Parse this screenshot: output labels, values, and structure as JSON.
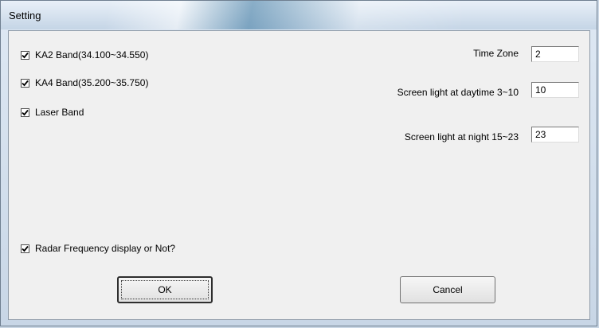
{
  "window": {
    "title": "Setting"
  },
  "bands": [
    {
      "label": "KA2 Band(34.100~34.550)",
      "checked": true
    },
    {
      "label": "KA4 Band(35.200~35.750)",
      "checked": true
    },
    {
      "label": "Laser Band",
      "checked": true
    }
  ],
  "radar_display": {
    "label": "Radar Frequency display or Not?",
    "checked": true
  },
  "fields": {
    "time_zone": {
      "label": "Time Zone",
      "value": "2"
    },
    "day_light": {
      "label": "Screen light at daytime 3~10",
      "value": "10"
    },
    "night_light": {
      "label": "Screen light at night 15~23",
      "value": "23"
    }
  },
  "buttons": {
    "ok": "OK",
    "cancel": "Cancel"
  }
}
